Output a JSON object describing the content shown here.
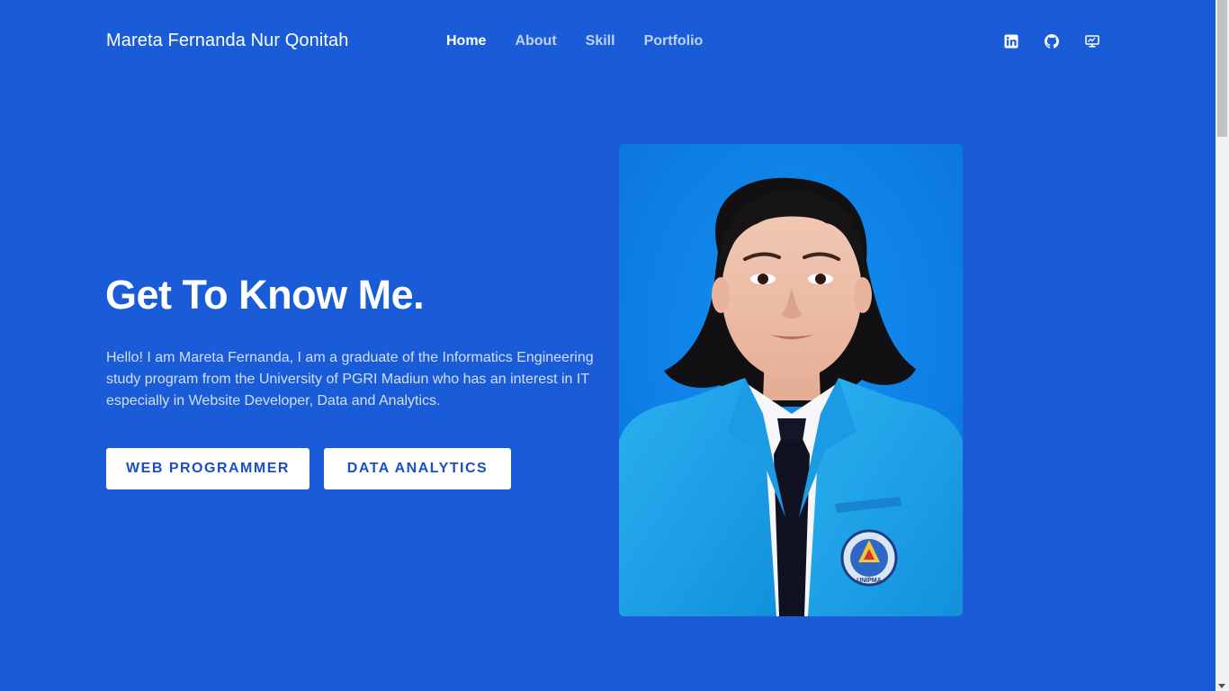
{
  "header": {
    "brand": "Mareta Fernanda Nur Qonitah",
    "nav": [
      {
        "label": "Home",
        "active": true
      },
      {
        "label": "About",
        "active": false
      },
      {
        "label": "Skill",
        "active": false
      },
      {
        "label": "Portfolio",
        "active": false
      }
    ],
    "social_icons": [
      "linkedin-icon",
      "github-icon",
      "monitor-icon"
    ]
  },
  "hero": {
    "title": "Get To Know Me.",
    "description": "Hello! I am Mareta Fernanda, I am a graduate of the Informatics Engineering study program from the University of PGRI Madiun who has an interest in IT especially in Website Developer, Data and Analytics.",
    "buttons": [
      {
        "label": "WEB PROGRAMMER"
      },
      {
        "label": "DATA ANALYTICS"
      }
    ],
    "portrait": {
      "badge_text": "UNIPMA",
      "badge_ring_text": "UNIVERSITAS PGRI MADIUN"
    }
  },
  "colors": {
    "background": "#1a5bd8",
    "button_bg": "#ffffff",
    "button_text": "#1a4fc4",
    "photo_bg": "#0c7fe6",
    "blazer": "#1aa3ea"
  }
}
